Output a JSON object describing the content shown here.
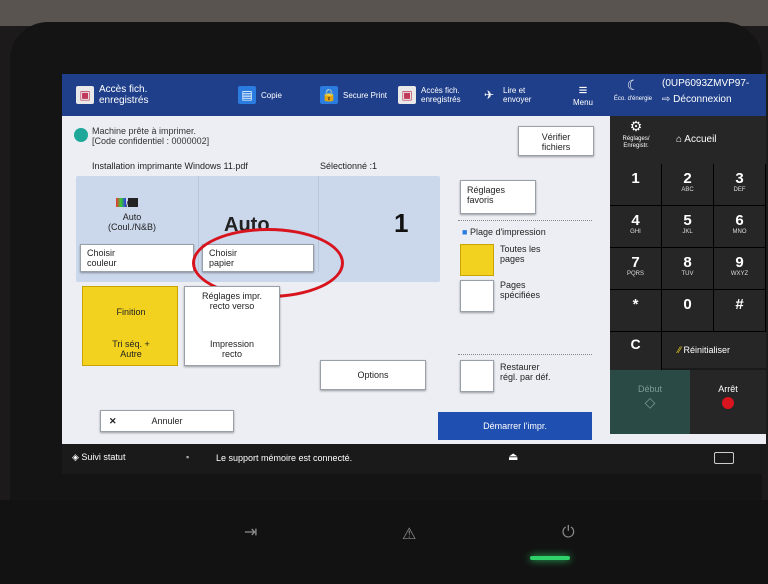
{
  "topbar": {
    "items": [
      {
        "label": "Accès fich.\nenregistrés",
        "icon": "stored-files-icon"
      },
      {
        "label": "Copie",
        "icon": "copy-icon"
      },
      {
        "label": "Secure Print",
        "icon": "lock-print-icon"
      },
      {
        "label": "Accès fich.\nenregistrés",
        "icon": "stored-files-icon"
      },
      {
        "label": "Lire et\nenvoyer",
        "icon": "send-icon"
      },
      {
        "label": "Menu",
        "icon": "hamburger-icon"
      }
    ],
    "eco_label": "Éco. d'énergie",
    "device_id": "(0UP6093ZMVP97-",
    "logout_label": "Déconnexion"
  },
  "status": {
    "ready": "Machine prête à imprimer.",
    "code": "[Code confidentiel : 0000002]",
    "verify": "Vérifier\nfichiers"
  },
  "file": {
    "name": "Installation imprimante Windows 11.pdf",
    "selected": "Sélectionné :1"
  },
  "settings": {
    "color_mode": "Auto\n(Coul./N&B)",
    "choose_color": "Choisir\ncouleur",
    "paper_value": "Auto",
    "choose_paper": "Choisir\npapier",
    "copies": "1",
    "favorites": "Réglages\nfavoris",
    "print_range": "Plage d'impression",
    "all_pages": "Toutes les\npages",
    "specified_pages": "Pages\nspécifiées",
    "finishing": "Finition",
    "finishing_value": "Tri séq. +\nAutre",
    "duplex_settings": "Réglages impr.\nrecto verso",
    "duplex_value": "Impression\nrecto",
    "options": "Options",
    "restore": "Restaurer\nrégl. par déf."
  },
  "actions": {
    "cancel": "Annuler",
    "start": "Démarrer l'impr."
  },
  "statusbar": {
    "status_monitor": "Suivi statut",
    "message": "Le support mémoire est connecté."
  },
  "keypad": {
    "settings_label": "Réglages/\nEnregistr.",
    "home_label": "Accueil",
    "keys": [
      {
        "main": "1",
        "sub": ""
      },
      {
        "main": "2",
        "sub": "ABC"
      },
      {
        "main": "3",
        "sub": "DEF"
      },
      {
        "main": "4",
        "sub": "GHI"
      },
      {
        "main": "5",
        "sub": "JKL"
      },
      {
        "main": "6",
        "sub": "MNO"
      },
      {
        "main": "7",
        "sub": "PQRS"
      },
      {
        "main": "8",
        "sub": "TUV"
      },
      {
        "main": "9",
        "sub": "WXYZ"
      },
      {
        "main": "*",
        "sub": ""
      },
      {
        "main": "0",
        "sub": ""
      },
      {
        "main": "#",
        "sub": ""
      }
    ],
    "clear": "C",
    "reset": "Réinitialiser",
    "start": "Début",
    "stop": "Arrêt"
  },
  "colors": {
    "nav_blue": "#1f3f8a",
    "highlight_yellow": "#f2d21f",
    "annotation_red": "#d8141e",
    "start_blue": "#1f4fb0"
  }
}
